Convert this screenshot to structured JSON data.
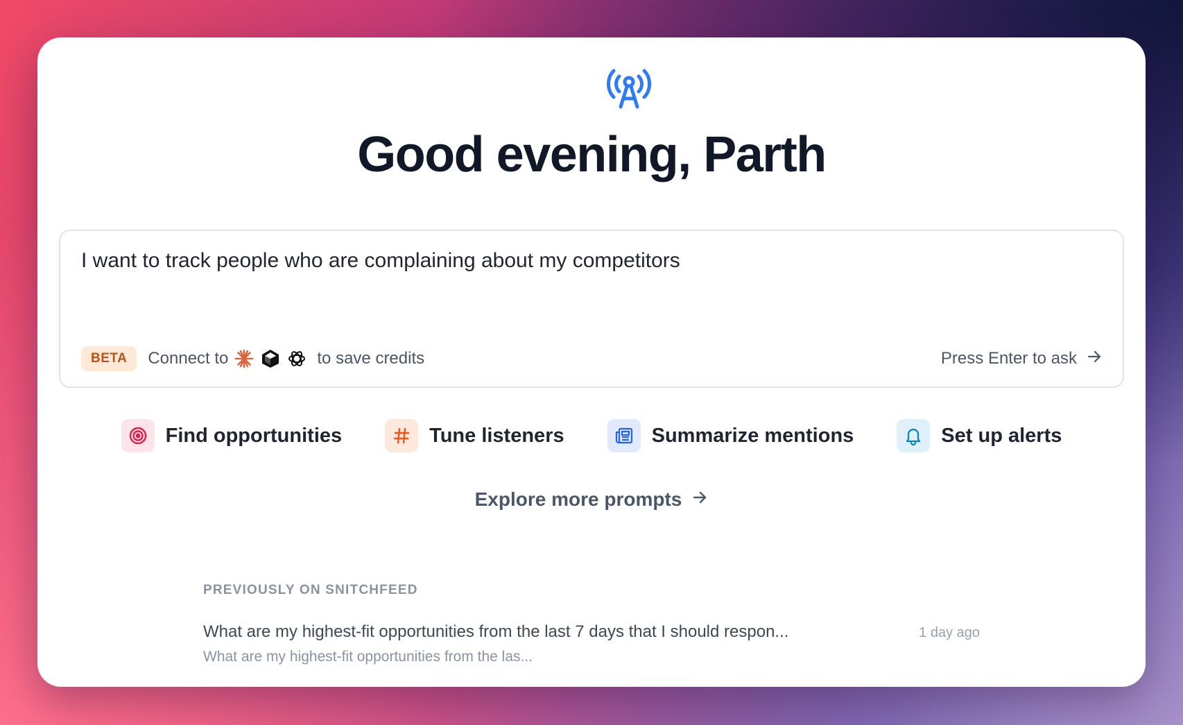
{
  "header": {
    "logo_icon": "broadcast-tower-icon",
    "greeting": "Good evening, Parth"
  },
  "ask": {
    "input_value": "I want to track people who are complaining about my competitors",
    "beta_badge": "BETA",
    "connect_label": "Connect to",
    "connect_icons": [
      "claude-icon",
      "cursor-icon",
      "openai-icon"
    ],
    "save_label": "to save credits",
    "enter_hint": "Press Enter to ask"
  },
  "quick_actions": [
    {
      "label": "Find opportunities",
      "icon": "target-icon",
      "color": "#e11d48"
    },
    {
      "label": "Tune listeners",
      "icon": "hash-icon",
      "color": "#f2541b"
    },
    {
      "label": "Summarize mentions",
      "icon": "newspaper-icon",
      "color": "#2563eb"
    },
    {
      "label": "Set up alerts",
      "icon": "bell-icon",
      "color": "#0284c7"
    }
  ],
  "explore": {
    "label": "Explore more prompts"
  },
  "history": {
    "section_label": "PREVIOUSLY ON SNITCHFEED",
    "items": [
      {
        "title": "What are my highest-fit opportunities from the last 7 days that I should respon...",
        "subtitle": "What are my highest-fit opportunities from the las...",
        "time": "1 day ago"
      }
    ]
  },
  "colors": {
    "accent": "#2f7bf5",
    "heading": "#111827",
    "beta_bg": "#fde9d6",
    "beta_fg": "#b4541a"
  }
}
